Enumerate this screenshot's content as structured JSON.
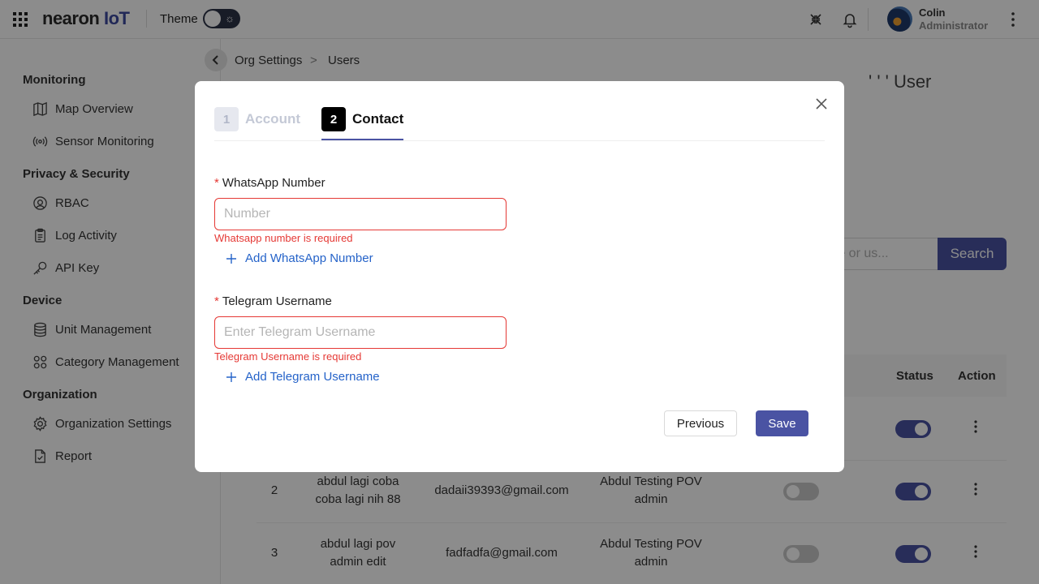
{
  "header": {
    "logo_main": "nearon",
    "logo_suffix": "IoT",
    "theme_label": "Theme",
    "user_name": "Colin",
    "user_role": "Administrator"
  },
  "sidebar": {
    "groups": [
      {
        "label": "Monitoring",
        "items": [
          {
            "label": "Map Overview",
            "icon": "map-icon"
          },
          {
            "label": "Sensor Monitoring",
            "icon": "broadcast-icon"
          }
        ]
      },
      {
        "label": "Privacy & Security",
        "items": [
          {
            "label": "RBAC",
            "icon": "user-circle-icon"
          },
          {
            "label": "Log Activity",
            "icon": "clipboard-icon"
          },
          {
            "label": "API Key",
            "icon": "key-icon"
          }
        ]
      },
      {
        "label": "Device",
        "items": [
          {
            "label": "Unit Management",
            "icon": "database-icon"
          },
          {
            "label": "Category Management",
            "icon": "grid-icon"
          }
        ]
      },
      {
        "label": "Organization",
        "items": [
          {
            "label": "Organization Settings",
            "icon": "gear-icon"
          },
          {
            "label": "Report",
            "icon": "file-check-icon"
          }
        ]
      }
    ]
  },
  "breadcrumb": {
    "parent": "Org Settings",
    "separator": ">",
    "current": "Users"
  },
  "background": {
    "card_title_fragment": "' ' ' User",
    "search_placeholder": "me or us...",
    "search_button": "Search",
    "table": {
      "headers": {
        "status": "Status",
        "action": "Action"
      },
      "rows": [
        {
          "no": "2",
          "name": "abdul lagi coba coba lagi nih 88",
          "email": "dadaii39393@gmail.com",
          "org": "Abdul Testing POV admin"
        },
        {
          "no": "3",
          "name": "abdul lagi pov admin edit",
          "email": "fadfadfa@gmail.com",
          "org": "Abdul Testing POV admin"
        }
      ]
    }
  },
  "modal": {
    "steps": [
      {
        "number": "1",
        "label": "Account",
        "state": "inactive"
      },
      {
        "number": "2",
        "label": "Contact",
        "state": "active"
      }
    ],
    "whatsapp": {
      "label": "WhatsApp Number",
      "required_mark": "*",
      "placeholder": "Number",
      "value": "",
      "error": "Whatsapp number is required",
      "add_label": "Add WhatsApp Number"
    },
    "telegram": {
      "label": "Telegram Username",
      "required_mark": "*",
      "placeholder": "Enter Telegram Username",
      "value": "",
      "error": "Telegram Username is required",
      "add_label": "Add Telegram Username"
    },
    "buttons": {
      "previous": "Previous",
      "save": "Save"
    }
  },
  "colors": {
    "primary": "#4a53a3",
    "error": "#e53935",
    "link": "#2563c9"
  }
}
